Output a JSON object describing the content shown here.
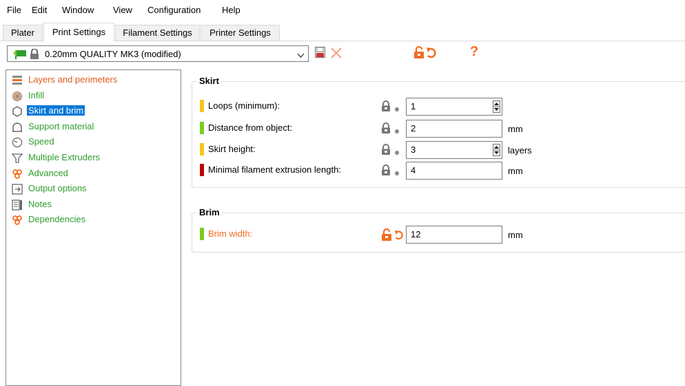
{
  "menu": [
    "File",
    "Edit",
    "Window",
    "View",
    "Configuration",
    "Help"
  ],
  "tabs": [
    "Plater",
    "Print Settings",
    "Filament Settings",
    "Printer Settings"
  ],
  "preset": {
    "name": "0.20mm QUALITY MK3 (modified)"
  },
  "tree": [
    {
      "label": "Layers and perimeters",
      "color": "#e05a1b",
      "icon": "layers-icon"
    },
    {
      "label": "Infill",
      "color": "#2e9e2e",
      "icon": "infill-icon"
    },
    {
      "label": "Skirt and brim",
      "color": "#2e9e2e",
      "icon": "skirt-icon",
      "selected": true
    },
    {
      "label": "Support material",
      "color": "#2e9e2e",
      "icon": "support-icon"
    },
    {
      "label": "Speed",
      "color": "#2e9e2e",
      "icon": "speed-icon"
    },
    {
      "label": "Multiple Extruders",
      "color": "#2e9e2e",
      "icon": "extruders-icon"
    },
    {
      "label": "Advanced",
      "color": "#2e9e2e",
      "icon": "advanced-icon"
    },
    {
      "label": "Output options",
      "color": "#2e9e2e",
      "icon": "output-icon"
    },
    {
      "label": "Notes",
      "color": "#2e9e2e",
      "icon": "notes-icon"
    },
    {
      "label": "Dependencies",
      "color": "#2e9e2e",
      "icon": "dependencies-icon"
    }
  ],
  "skirt": {
    "title": "Skirt",
    "options": [
      {
        "label": "Loops (minimum):",
        "value": "1",
        "unit": "",
        "mode_color": "#f5c518",
        "spin": true
      },
      {
        "label": "Distance from object:",
        "value": "2",
        "unit": "mm",
        "mode_color": "#7ccb1f",
        "spin": false
      },
      {
        "label": "Skirt height:",
        "value": "3",
        "unit": "layers",
        "mode_color": "#f5c518",
        "spin": true
      },
      {
        "label": "Minimal filament extrusion length:",
        "value": "4",
        "unit": "mm",
        "mode_color": "#c00000",
        "spin": false
      }
    ]
  },
  "brim": {
    "title": "Brim",
    "options": [
      {
        "label": "Brim width:",
        "value": "12",
        "unit": "mm",
        "mode_color": "#7ccb1f",
        "modified": true
      }
    ]
  },
  "colors": {
    "modified": "#f26d21",
    "system": "#2e9e2e",
    "selected": "#0078d7"
  }
}
